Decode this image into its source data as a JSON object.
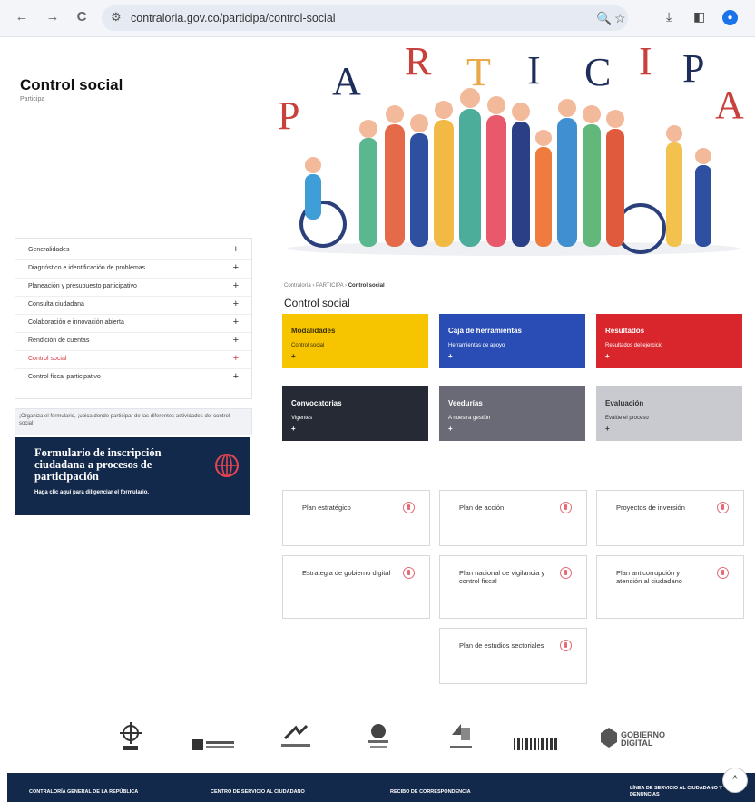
{
  "browser": {
    "url": "contraloria.gov.co/participa/control-social",
    "back": "←",
    "forward": "→",
    "reload": "C"
  },
  "left": {
    "title": "Control social",
    "subtitle": "Participa",
    "menu": [
      {
        "label": "Generalidades",
        "plus": "+"
      },
      {
        "label": "Diagnóstico e identificación de problemas",
        "plus": "+"
      },
      {
        "label": "Planeación y presupuesto participativo",
        "plus": "+"
      },
      {
        "label": "Consulta ciudadana",
        "plus": "+"
      },
      {
        "label": "Colaboración e innovación abierta",
        "plus": "+"
      },
      {
        "label": "Rendición de cuentas",
        "plus": "+"
      },
      {
        "label": "Control social",
        "plus": "+",
        "active": true
      },
      {
        "label": "Control fiscal participativo",
        "plus": "+"
      }
    ],
    "info": "¡Organiza el formulario, ¡ubica donde participar de las diferentes actividades del control social!",
    "form_card": {
      "title": "Formulario de inscripción ciudadana a procesos de participación",
      "subtitle": "Haga clic aquí para diligenciar el formulario."
    }
  },
  "hero": {
    "letters": [
      "P",
      "A",
      "R",
      "T",
      "I",
      "C",
      "I",
      "P",
      "A"
    ],
    "letter_colors": [
      "#c9413c",
      "#1e2d5a",
      "#c9413c",
      "#e8a94a",
      "#1e2d5a",
      "#1e2d5a",
      "#c9413c",
      "#1e2d5a",
      "#c9413c"
    ]
  },
  "breadcrumb": {
    "path": "Contraloría › PARTICIPA › ",
    "current": "Control social"
  },
  "section_title": "Control social",
  "tiles": [
    {
      "title": "Modalidades",
      "sub": "Control social",
      "plus": "+",
      "bg": "#f7c400",
      "fg": "#3a3000"
    },
    {
      "title": "Caja de herramientas",
      "sub": "Herramientas de apoyo",
      "plus": "+",
      "bg": "#2a4db5",
      "fg": "#ffffff"
    },
    {
      "title": "Resultados",
      "sub": "Resultados del ejercicio",
      "plus": "+",
      "bg": "#d9262d",
      "fg": "#ffffff"
    },
    {
      "title": "Convocatorias",
      "sub": "Vigentes",
      "plus": "+",
      "bg": "#262a35",
      "fg": "#ffffff"
    },
    {
      "title": "Veedurías",
      "sub": "A nuestra gestión",
      "plus": "+",
      "bg": "#696a75",
      "fg": "#ffffff"
    },
    {
      "title": "Evaluación",
      "sub": "Evalúe el proceso",
      "plus": "+",
      "bg": "#c9cad0",
      "fg": "#333333"
    }
  ],
  "plans": [
    {
      "label": "Plan estratégico"
    },
    {
      "label": "Plan de acción"
    },
    {
      "label": "Proyectos de inversión"
    },
    {
      "label": "Estrategia de gobierno digital"
    },
    {
      "label": "Plan nacional de vigilancia y control fiscal"
    },
    {
      "label": "Plan anticorrupción y atención al ciudadano"
    },
    {
      "label": "Plan de estudios sectoriales"
    }
  ],
  "logos": {
    "gobierno_digital": "GOBIERNO DIGITAL"
  },
  "footer": [
    "CONTRALORÍA GENERAL DE LA REPÚBLICA",
    "CENTRO DE SERVICIO AL CIUDADANO",
    "RECIBO DE CORRESPONDENCIA",
    "LÍNEA DE SERVICIO AL CIUDADANO Y DENUNCIAS"
  ],
  "scroll_top": "^"
}
